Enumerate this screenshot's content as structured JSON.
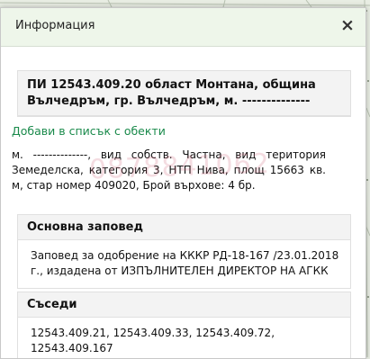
{
  "dialog": {
    "title": "Информация",
    "close_icon": "close-icon"
  },
  "property": {
    "heading": "ПИ 12543.409.20 област Монтана, община Вълчедръм, гр. Вълчедръм, м. --------------",
    "add_link": "Добави в списък с обекти",
    "description": "м. --------------, вид собств. Частна, вид територия Земеделска, категория 3, НТП Нива, площ 15663 кв. м, стар номер 409020, Брой върхове: 4 бр.",
    "watermark": "0878841062"
  },
  "order": {
    "heading": "Основна заповед",
    "text": "Заповед за одобрение на КККР РД-18-167 /23.01.2018 г., издадена от ИЗПЪЛНИТЕЛЕН ДИРЕКТОР НА АГКК"
  },
  "neighbors": {
    "heading": "Съседи",
    "text": "12543.409.21, 12543.409.33, 12543.409.72, 12543.409.167"
  }
}
